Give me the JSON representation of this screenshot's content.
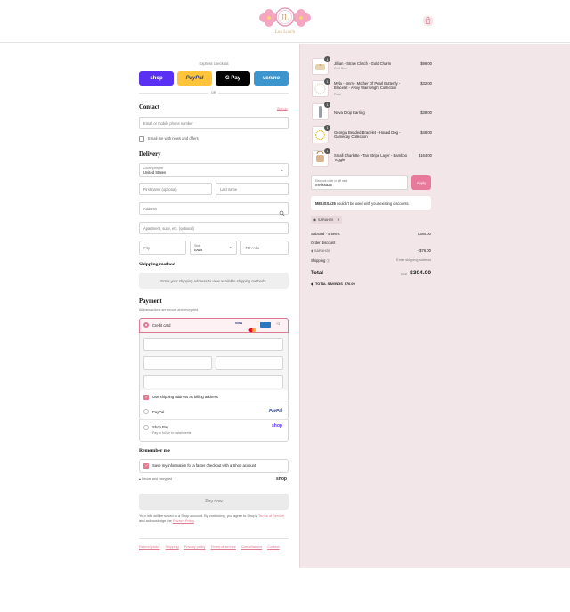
{
  "header": {
    "logo_text": "Lux Lunch",
    "cart_icon": "shopping-bag-icon"
  },
  "express": {
    "title": "Express checkout",
    "buttons": [
      {
        "label": "shop",
        "color": "#5a31f4"
      },
      {
        "label": "PayPal",
        "color": "#ffc439"
      },
      {
        "label": "G Pay",
        "color": "#000000"
      },
      {
        "label": "venmo",
        "color": "#3d95ce"
      }
    ],
    "or": "OR"
  },
  "contact": {
    "title": "Contact",
    "sign_in": "Sign in",
    "email_placeholder": "Email or mobile phone number",
    "news_label": "Email me with news and offers"
  },
  "delivery": {
    "title": "Delivery",
    "country_label": "Country/Region",
    "country_value": "United States",
    "first_name": "First name (optional)",
    "last_name": "Last name",
    "address": "Address",
    "apartment": "Apartment, suite, etc. (optional)",
    "city": "City",
    "state_label": "State",
    "state_value": "Iowa",
    "zip": "ZIP code"
  },
  "shipping": {
    "title": "Shipping method",
    "message": "Enter your shipping address to view available shipping methods."
  },
  "payment": {
    "title": "Payment",
    "subtitle": "All transactions are secure and encrypted.",
    "credit_card": "Credit card",
    "more_cards": "+3",
    "billing_label": "Use shipping address as billing address",
    "paypal": "PayPal",
    "paypal_logo": "PayPal",
    "shoppay": "Shop Pay",
    "shoppay_sub": "Pay in full or in installments",
    "shoppay_logo": "shop"
  },
  "remember": {
    "title": "Remember me",
    "label": "Save my information for a faster checkout with a Shop account",
    "secure": "Secure and encrypted",
    "shop_logo": "shop"
  },
  "pay_now": "Pay now",
  "legal": {
    "text1": "Your info will be saved to a Shop account. By continuing, you agree to Shop's",
    "tos": "Terms of Service",
    "text2": "and acknowledge the",
    "privacy": "Privacy Policy",
    "period": "."
  },
  "footer_links": [
    "Refund policy",
    "Shipping",
    "Privacy policy",
    "Terms of service",
    "Cancellations",
    "Contact"
  ],
  "cart": {
    "items": [
      {
        "name": "Jillian - Straw Clutch - Gold Charm",
        "variant": "Gold Bow",
        "price": "$98.00",
        "qty": "1"
      },
      {
        "name": "Myla - 6mm - Mother Of Pearl Butterfly - Bracelet - Avoiy Wainwright Collection",
        "variant": "Pearl",
        "price": "$32.00",
        "qty": "1"
      },
      {
        "name": "Nova Drop Earring",
        "variant": "",
        "price": "$38.00",
        "qty": "1"
      },
      {
        "name": "Georgia Beaded Bracelet - Hound Dog - Gameday Collection",
        "variant": "",
        "price": "$48.00",
        "qty": "1"
      },
      {
        "name": "Small Charlotte - Tan Stripe Layer - Bamboo Toggle",
        "variant": "",
        "price": "$164.00",
        "qty": "1"
      }
    ],
    "discount_label": "Discount code or gift card",
    "discount_value": "melissa25",
    "apply": "Apply",
    "error_code": "MELISSA25",
    "error_text": "couldn't be used with your existing discounts.",
    "applied_code": "SARAH20",
    "subtotal_label": "Subtotal · 5 items",
    "subtotal": "$380.00",
    "order_discount_label": "Order discount",
    "discount_code": "SARAH20",
    "discount_amount": "- $76.00",
    "shipping_label": "Shipping",
    "shipping_value": "Enter shipping address",
    "total_label": "Total",
    "currency": "USD",
    "total": "$304.00",
    "savings_label": "TOTAL SAVINGS",
    "savings": "$76.00"
  }
}
